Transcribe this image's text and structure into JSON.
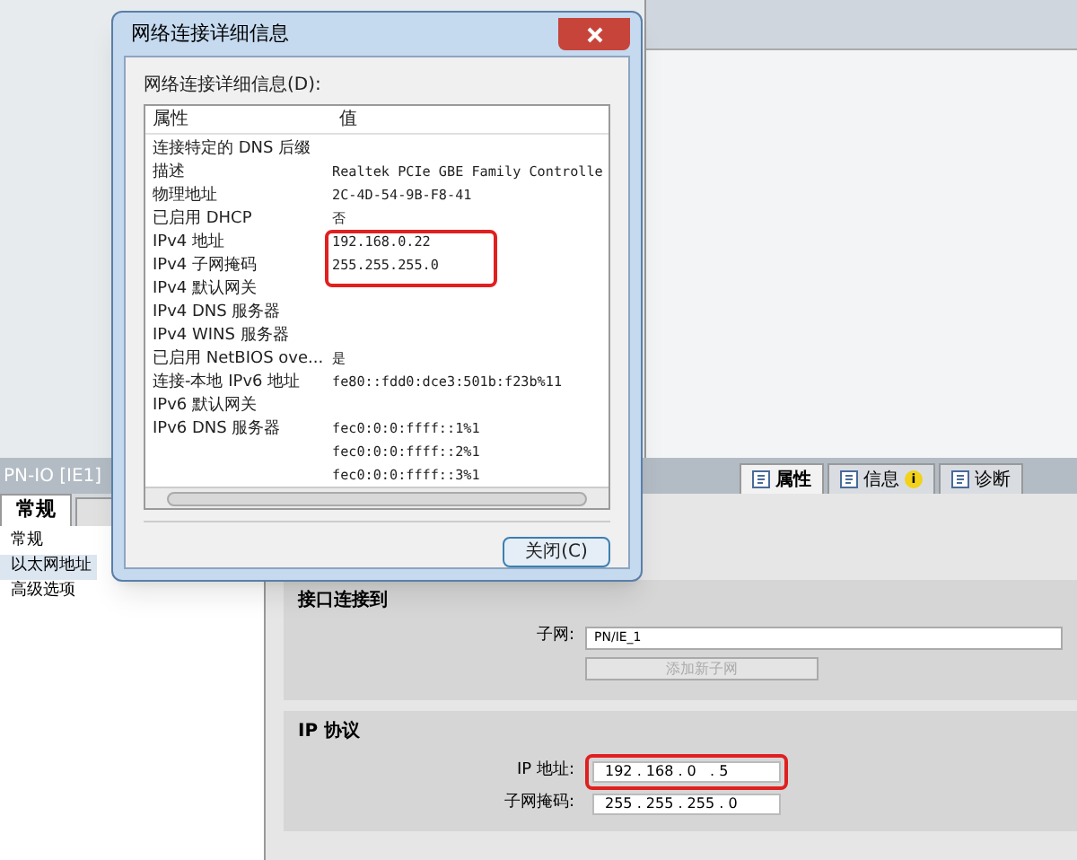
{
  "device_bar": {
    "title": "PN-IO [IE1]",
    "tabs": [
      {
        "label": "属性",
        "selected": true
      },
      {
        "label": "信息",
        "selected": false,
        "badge": "i"
      },
      {
        "label": "诊断",
        "selected": false
      }
    ]
  },
  "sidebar": {
    "tabs": [
      {
        "label": "常规",
        "selected": true
      }
    ],
    "items": [
      {
        "label": "常规",
        "selected": false
      },
      {
        "label": "以太网地址",
        "selected": true
      },
      {
        "label": "高级选项",
        "selected": false
      }
    ]
  },
  "sections": [
    {
      "title": "接口连接到",
      "fields": [
        {
          "kind": "dropdown",
          "label": "子网:",
          "value": "PN/IE_1"
        },
        {
          "kind": "button",
          "label": "添加新子网",
          "disabled": true
        }
      ]
    },
    {
      "title": "IP 协议",
      "fields": [
        {
          "kind": "ip",
          "label": "IP 地址:",
          "value": "192 . 168 . 0   . 5",
          "highlighted": true
        },
        {
          "kind": "ip",
          "label": "子网掩码:",
          "value": "255 . 255 . 255 . 0",
          "highlighted": false
        }
      ]
    }
  ],
  "dialog": {
    "title": "网络连接详细信息",
    "list_label": "网络连接详细信息(D):",
    "columns": [
      "属性",
      "值"
    ],
    "rows": [
      {
        "property": "连接特定的 DNS 后缀"
      },
      {
        "property": "描述",
        "values": [
          "Realtek PCIe GBE Family Controlle"
        ]
      },
      {
        "property": "物理地址",
        "values": [
          "2C-4D-54-9B-F8-41"
        ]
      },
      {
        "property": "已启用 DHCP",
        "values": [
          "否"
        ]
      },
      {
        "property": "IPv4 地址",
        "values": [
          "192.168.0.22"
        ],
        "highlighted": true
      },
      {
        "property": "IPv4 子网掩码",
        "values": [
          "255.255.255.0"
        ],
        "highlighted": true
      },
      {
        "property": "IPv4 默认网关"
      },
      {
        "property": "IPv4 DNS 服务器"
      },
      {
        "property": "IPv4 WINS 服务器"
      },
      {
        "property": "已启用 NetBIOS ove...",
        "values": [
          "是"
        ]
      },
      {
        "property": "连接-本地 IPv6 地址",
        "values": [
          "fe80::fdd0:dce3:501b:f23b%11"
        ]
      },
      {
        "property": "IPv6 默认网关"
      },
      {
        "property": "IPv6 DNS 服务器",
        "values": [
          "fec0:0:0:ffff::1%1",
          "fec0:0:0:ffff::2%1",
          "fec0:0:0:ffff::3%1"
        ]
      }
    ],
    "close_button": "关闭(C)"
  }
}
